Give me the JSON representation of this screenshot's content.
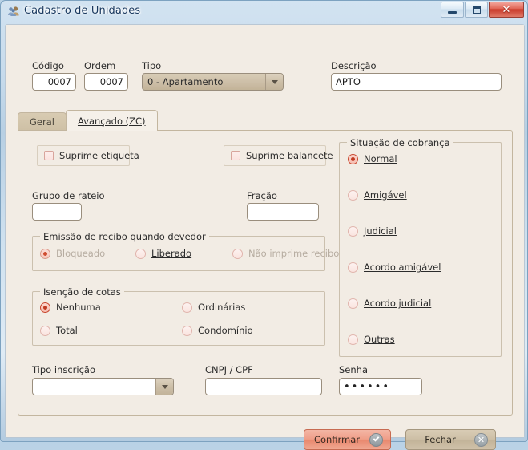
{
  "window": {
    "title": "Cadastro de Unidades",
    "icon": "users-group-icon",
    "minimize_label": "Minimizar",
    "maximize_label": "Restaurar",
    "close_label": "Fechar"
  },
  "header": {
    "codigo": {
      "label": "Código",
      "value": "0007"
    },
    "ordem": {
      "label": "Ordem",
      "value": "0007"
    },
    "tipo": {
      "label": "Tipo",
      "value": "0 - Apartamento",
      "options": [
        "0 - Apartamento"
      ]
    },
    "descricao": {
      "label": "Descrição",
      "value": "APTO",
      "placeholder": ""
    }
  },
  "tabs": [
    {
      "label": "Geral",
      "active": false
    },
    {
      "label": "Avançado (ZC)",
      "active": true
    }
  ],
  "advanced": {
    "suprime_etiqueta": {
      "label": "Suprime etiqueta",
      "accel": "e",
      "checked": false
    },
    "suprime_balancete": {
      "label": "Suprime balancete",
      "accel": "b",
      "checked": false
    },
    "grupo_rateio": {
      "label": "Grupo de rateio",
      "value": "",
      "placeholder": ""
    },
    "fracao": {
      "label": "Fração",
      "value": "",
      "placeholder": ""
    },
    "emissao_recibo": {
      "title": "Emissão de recibo quando devedor",
      "options": [
        {
          "label": "Bloqueado",
          "accel": "d",
          "selected": true,
          "disabled": true
        },
        {
          "label": "Liberado",
          "accel": "L",
          "selected": false,
          "disabled": false
        },
        {
          "label": "Não imprime recibo",
          "accel": "r",
          "selected": false,
          "disabled": true
        }
      ]
    },
    "isencao_cotas": {
      "title": "Isenção de cotas",
      "options": [
        {
          "label": "Nenhuma",
          "selected": true
        },
        {
          "label": "Ordinárias",
          "selected": false
        },
        {
          "label": "Total",
          "selected": false
        },
        {
          "label": "Condomínio",
          "selected": false
        }
      ]
    },
    "situacao_cobranca": {
      "title": "Situação de cobrança",
      "options": [
        {
          "label": "Normal",
          "accel": "N",
          "selected": true
        },
        {
          "label": "Amigável",
          "accel": "v",
          "selected": false
        },
        {
          "label": "Judicial",
          "accel": "J",
          "selected": false
        },
        {
          "label": "Acordo amigável",
          "accel": "i",
          "selected": false
        },
        {
          "label": "Acordo judicial",
          "accel": "c",
          "selected": false
        },
        {
          "label": "Outras",
          "accel": "O",
          "selected": false
        }
      ]
    },
    "tipo_inscricao": {
      "label": "Tipo inscrição",
      "value": "",
      "options": []
    },
    "cnpj_cpf": {
      "label": "CNPJ / CPF",
      "value": "",
      "placeholder": ""
    },
    "senha": {
      "label": "Senha",
      "value": "••••••",
      "masked_length": 6
    }
  },
  "footer": {
    "confirm": {
      "label": "Confirmar",
      "icon": "check-circle-icon"
    },
    "close": {
      "label": "Fechar",
      "icon": "x-circle-icon"
    }
  },
  "colors": {
    "accent_red": "#c03a22",
    "confirm_button": "#ef9e88",
    "close_button": "#cdbfa6",
    "panel_bg": "#f2ece4",
    "tab_active": "#f5f0e9",
    "tab_inactive": "#cec0a5",
    "input_border": "#9a8e7d",
    "group_border": "#cbc0ae",
    "title_text": "#17375e"
  }
}
